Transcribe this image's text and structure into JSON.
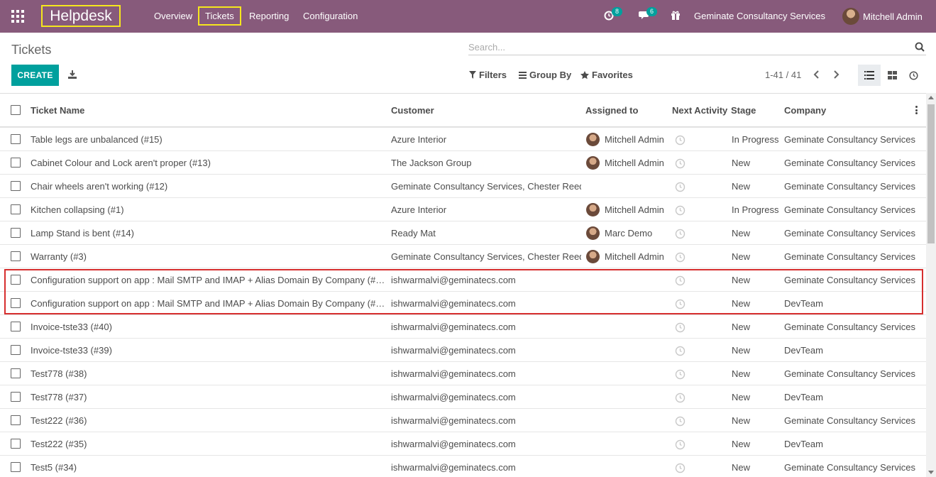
{
  "navbar": {
    "brand": "Helpdesk",
    "menu": [
      "Overview",
      "Tickets",
      "Reporting",
      "Configuration"
    ],
    "activity_count": "8",
    "messages_count": "6",
    "company": "Geminate Consultancy Services",
    "user": "Mitchell Admin",
    "color": "#875a7b"
  },
  "control_panel": {
    "title": "Tickets",
    "search_placeholder": "Search...",
    "create_label": "CREATE",
    "filters_label": "Filters",
    "group_by_label": "Group By",
    "favorites_label": "Favorites",
    "pager": "1-41 / 41",
    "accent": "#00a09d"
  },
  "table": {
    "columns": {
      "name": "Ticket Name",
      "customer": "Customer",
      "assigned": "Assigned to",
      "activity": "Next Activity",
      "stage": "Stage",
      "company": "Company"
    },
    "rows": [
      {
        "name": "Table legs are unbalanced (#15)",
        "customer": "Azure Interior",
        "assigned": "Mitchell Admin",
        "stage": "In Progress",
        "company": "Geminate Consultancy Services"
      },
      {
        "name": "Cabinet Colour and Lock aren't proper (#13)",
        "customer": "The Jackson Group",
        "assigned": "Mitchell Admin",
        "stage": "New",
        "company": "Geminate Consultancy Services"
      },
      {
        "name": "Chair wheels aren't working (#12)",
        "customer": "Geminate Consultancy Services, Chester Reed",
        "assigned": "",
        "stage": "New",
        "company": "Geminate Consultancy Services"
      },
      {
        "name": "Kitchen collapsing (#1)",
        "customer": "Azure Interior",
        "assigned": "Mitchell Admin",
        "stage": "In Progress",
        "company": "Geminate Consultancy Services"
      },
      {
        "name": "Lamp Stand is bent (#14)",
        "customer": "Ready Mat",
        "assigned": "Marc Demo",
        "stage": "New",
        "company": "Geminate Consultancy Services"
      },
      {
        "name": "Warranty (#3)",
        "customer": "Geminate Consultancy Services, Chester Reed",
        "assigned": "Mitchell Admin",
        "stage": "New",
        "company": "Geminate Consultancy Services"
      },
      {
        "name": "Configuration support on app : Mail SMTP and IMAP + Alias Domain By Company (#4…",
        "customer": "ishwarmalvi@geminatecs.com",
        "assigned": "",
        "stage": "New",
        "company": "Geminate Consultancy Services"
      },
      {
        "name": "Configuration support on app : Mail SMTP and IMAP + Alias Domain By Company (#4…",
        "customer": "ishwarmalvi@geminatecs.com",
        "assigned": "",
        "stage": "New",
        "company": "DevTeam"
      },
      {
        "name": "Invoice-tste33 (#40)",
        "customer": "ishwarmalvi@geminatecs.com",
        "assigned": "",
        "stage": "New",
        "company": "Geminate Consultancy Services"
      },
      {
        "name": "Invoice-tste33 (#39)",
        "customer": "ishwarmalvi@geminatecs.com",
        "assigned": "",
        "stage": "New",
        "company": "DevTeam"
      },
      {
        "name": "Test778 (#38)",
        "customer": "ishwarmalvi@geminatecs.com",
        "assigned": "",
        "stage": "New",
        "company": "Geminate Consultancy Services"
      },
      {
        "name": "Test778 (#37)",
        "customer": "ishwarmalvi@geminatecs.com",
        "assigned": "",
        "stage": "New",
        "company": "DevTeam"
      },
      {
        "name": "Test222 (#36)",
        "customer": "ishwarmalvi@geminatecs.com",
        "assigned": "",
        "stage": "New",
        "company": "Geminate Consultancy Services"
      },
      {
        "name": "Test222 (#35)",
        "customer": "ishwarmalvi@geminatecs.com",
        "assigned": "",
        "stage": "New",
        "company": "DevTeam"
      },
      {
        "name": "Test5 (#34)",
        "customer": "ishwarmalvi@geminatecs.com",
        "assigned": "",
        "stage": "New",
        "company": "Geminate Consultancy Services"
      }
    ]
  }
}
